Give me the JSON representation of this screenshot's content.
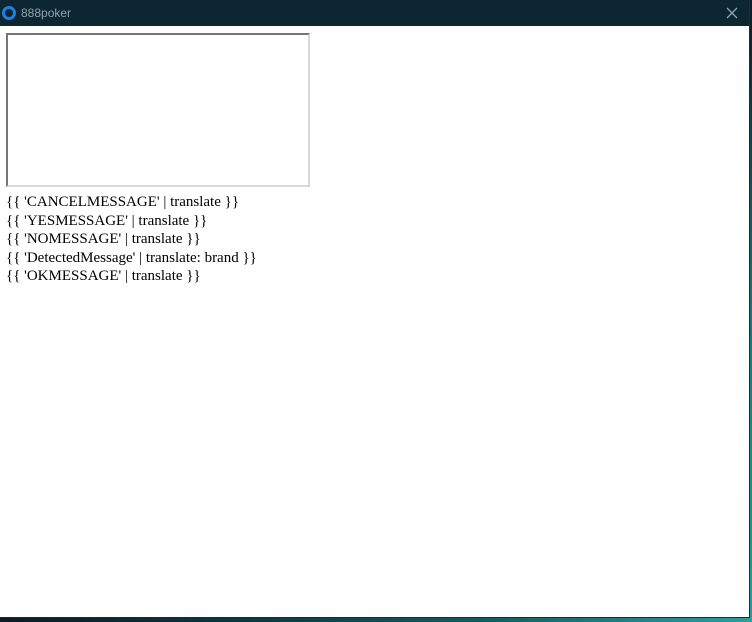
{
  "window": {
    "title": "888poker",
    "app_icon": "circle-logo-icon",
    "close_icon": "close-icon",
    "accent_color": "#1f7fe0",
    "titlebar_color": "#0c2632"
  },
  "content": {
    "messages": [
      "{{ 'CANCELMESSAGE' | translate }}",
      "{{ 'YESMESSAGE' | translate }}",
      "{{ 'NOMESSAGE' | translate }}",
      "{{ 'DetectedMessage' | translate: brand }}",
      "{{ 'OKMESSAGE' | translate }}"
    ]
  }
}
